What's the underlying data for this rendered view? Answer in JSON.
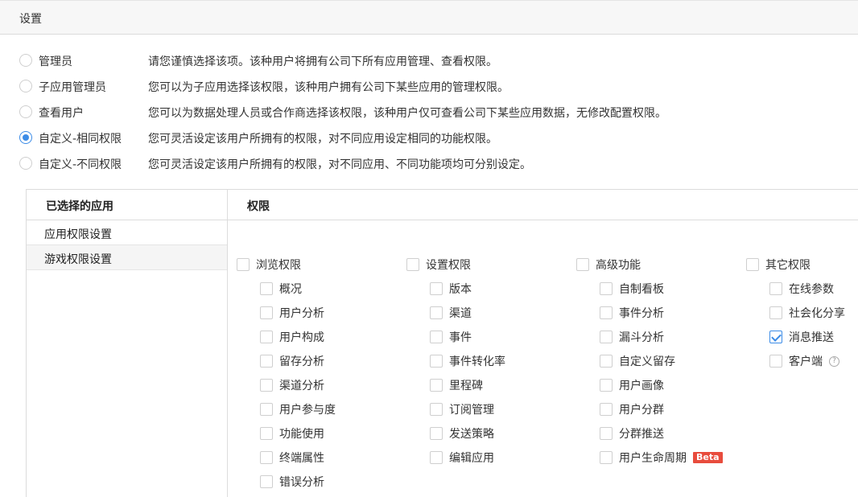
{
  "header": {
    "title": "设置"
  },
  "roles": [
    {
      "label": "管理员",
      "desc": "请您谨慎选择该项。该种用户将拥有公司下所有应用管理、查看权限。",
      "checked": false
    },
    {
      "label": "子应用管理员",
      "desc": "您可以为子应用选择该权限，该种用户拥有公司下某些应用的管理权限。",
      "checked": false
    },
    {
      "label": "查看用户",
      "desc": "您可以为数据处理人员或合作商选择该权限，该种用户仅可查看公司下某些应用数据，无修改配置权限。",
      "checked": false
    },
    {
      "label": "自定义-相同权限",
      "desc": "您可灵活设定该用户所拥有的权限，对不同应用设定相同的功能权限。",
      "checked": true
    },
    {
      "label": "自定义-不同权限",
      "desc": "您可灵活设定该用户所拥有的权限，对不同应用、不同功能项均可分别设定。",
      "checked": false
    }
  ],
  "panel": {
    "left_header": "已选择的应用",
    "right_header": "权限",
    "apps": [
      {
        "label": "应用权限设置",
        "active": false
      },
      {
        "label": "游戏权限设置",
        "active": true
      }
    ]
  },
  "permissions": [
    {
      "label": "浏览权限",
      "checked": false,
      "items": [
        {
          "label": "概况",
          "checked": false
        },
        {
          "label": "用户分析",
          "checked": false
        },
        {
          "label": "用户构成",
          "checked": false
        },
        {
          "label": "留存分析",
          "checked": false
        },
        {
          "label": "渠道分析",
          "checked": false
        },
        {
          "label": "用户参与度",
          "checked": false
        },
        {
          "label": "功能使用",
          "checked": false
        },
        {
          "label": "终端属性",
          "checked": false
        },
        {
          "label": "错误分析",
          "checked": false
        }
      ]
    },
    {
      "label": "设置权限",
      "checked": false,
      "items": [
        {
          "label": "版本",
          "checked": false
        },
        {
          "label": "渠道",
          "checked": false
        },
        {
          "label": "事件",
          "checked": false
        },
        {
          "label": "事件转化率",
          "checked": false
        },
        {
          "label": "里程碑",
          "checked": false
        },
        {
          "label": "订阅管理",
          "checked": false
        },
        {
          "label": "发送策略",
          "checked": false
        },
        {
          "label": "编辑应用",
          "checked": false
        }
      ]
    },
    {
      "label": "高级功能",
      "checked": false,
      "items": [
        {
          "label": "自制看板",
          "checked": false
        },
        {
          "label": "事件分析",
          "checked": false
        },
        {
          "label": "漏斗分析",
          "checked": false
        },
        {
          "label": "自定义留存",
          "checked": false
        },
        {
          "label": "用户画像",
          "checked": false
        },
        {
          "label": "用户分群",
          "checked": false
        },
        {
          "label": "分群推送",
          "checked": false
        },
        {
          "label": "用户生命周期",
          "checked": false,
          "badge": "Beta"
        }
      ]
    },
    {
      "label": "其它权限",
      "checked": false,
      "items": [
        {
          "label": "在线参数",
          "checked": false
        },
        {
          "label": "社会化分享",
          "checked": false
        },
        {
          "label": "消息推送",
          "checked": true
        },
        {
          "label": "客户端",
          "checked": false,
          "help": "?"
        }
      ]
    }
  ],
  "colors": {
    "accent": "#3c8ce7",
    "beta_badge": "#e84c3d"
  }
}
